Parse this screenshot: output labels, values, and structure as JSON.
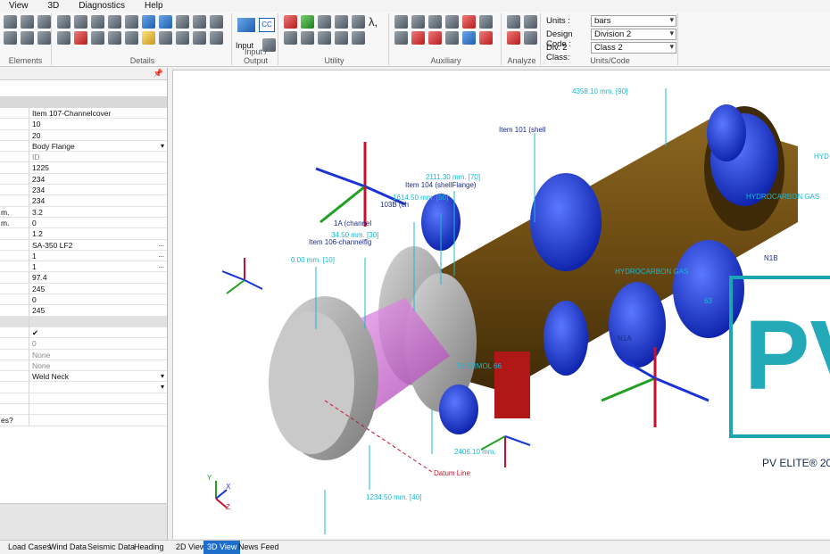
{
  "menu": [
    "View",
    "3D",
    "Diagnostics",
    "Help"
  ],
  "ribbon": {
    "groups": [
      "Elements",
      "Details",
      "Input / Output",
      "Utility",
      "Auxiliary",
      "Analyze",
      "Units/Code"
    ],
    "input_button": "Input",
    "lambda_icon": "λ,"
  },
  "units": {
    "units_label": "Units :",
    "units_value": "bars",
    "code_label": "Design Code :",
    "code_value": "Division 2",
    "class_label": "Div. 2 Class:",
    "class_value": "Class 2"
  },
  "properties": [
    {
      "k": "",
      "v": "Item 107-Channelcover"
    },
    {
      "k": "",
      "v": "10"
    },
    {
      "k": "",
      "v": "20"
    },
    {
      "k": "",
      "v": "Body Flange",
      "dd": true
    },
    {
      "k": "",
      "v": "ID",
      "dim": true
    },
    {
      "k": "",
      "v": "1225"
    },
    {
      "k": "",
      "v": "234"
    },
    {
      "k": "",
      "v": "234"
    },
    {
      "k": "",
      "v": "234"
    },
    {
      "k": "m.",
      "v": "3.2"
    },
    {
      "k": "m.",
      "v": "0"
    },
    {
      "k": "",
      "v": "1.2"
    },
    {
      "k": "",
      "v": "SA-350 LF2",
      "dots": true
    },
    {
      "k": "",
      "v": "1",
      "dots": true
    },
    {
      "k": "",
      "v": "1",
      "dots": true
    },
    {
      "k": "",
      "v": "97.4"
    },
    {
      "k": "",
      "v": "245"
    },
    {
      "k": "",
      "v": "0"
    },
    {
      "k": "",
      "v": "245"
    },
    {
      "k": "",
      "v": "",
      "sep": true
    },
    {
      "k": "",
      "v": "✔"
    },
    {
      "k": "",
      "v": "0",
      "dim": true
    },
    {
      "k": "",
      "v": "None",
      "dim": true
    },
    {
      "k": "",
      "v": "None",
      "dim": true
    },
    {
      "k": "",
      "v": "Weld Neck",
      "dd": true
    },
    {
      "k": "",
      "v": "",
      "dd": true
    },
    {
      "k": "",
      "v": ""
    },
    {
      "k": "",
      "v": ""
    },
    {
      "k": "es?",
      "v": ""
    }
  ],
  "view_labels": {
    "dim_4358": "4358.10 mm.  [90]",
    "item101": "Item 101 (shell",
    "dim_2111": "2111.30 mm.  [70]",
    "item104": "Item 104 (shellFlange)",
    "dim_1614": "1614.50 mm.  [50]",
    "item103": "103B (ch",
    "item1a": "1A (channel",
    "dim_34": "34.50 mm.  [30]",
    "item106": "Item 106-channelflg",
    "dim_0": "0.00 mm.  [10]",
    "hyd_gas": "HYDROCARBON GAS",
    "hyd_gas2": "HYDROCARBON GAS",
    "hyd_right": "HYD",
    "n1b": "N1B",
    "n1a": "N1A",
    "thermal": "THERMOL 66",
    "dim_63": "63",
    "dim_2406": "2406.10 mm.",
    "datum": "Datum Line",
    "dim_1234": "1234.50 mm.  [40]",
    "brand": "PV ELITE® 20",
    "brand_big": "PV"
  },
  "bottom_tabs_left": [
    "Load Cases",
    "Wind Data",
    "Seismic Data",
    "Heading"
  ],
  "bottom_tabs_view": [
    "2D View",
    "3D View",
    "News Feed"
  ],
  "colors": {
    "accent": "#1e6fcb",
    "flange": "#1a33d6",
    "shell": "#6b4a12",
    "steel": "#a9a9a9",
    "magenta": "#d96ee0",
    "dim_cyan": "#19b8d4"
  }
}
